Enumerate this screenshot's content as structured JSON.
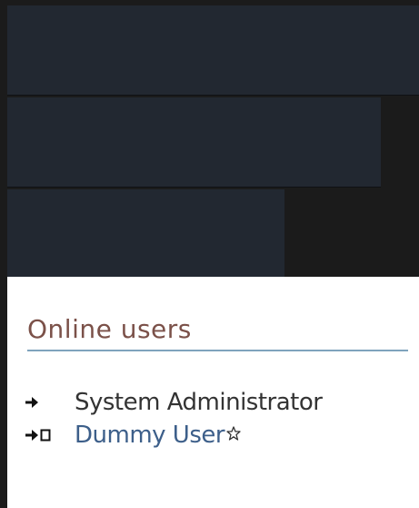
{
  "online_users": {
    "title": "Online users",
    "users": [
      {
        "name": "System Administrator",
        "is_link": false,
        "icons": [
          "arrow-right-icon"
        ]
      },
      {
        "name": "Dummy User",
        "is_link": true,
        "icons": [
          "arrow-right-icon",
          "document-icon"
        ],
        "badge_icon": "star-icon"
      }
    ]
  },
  "colors": {
    "title": "#7b5149",
    "rule": "#7fa3bd",
    "link": "#3d5f8a",
    "text": "#333333",
    "header_blocks": "#222831",
    "background": "#1b1b1b"
  }
}
